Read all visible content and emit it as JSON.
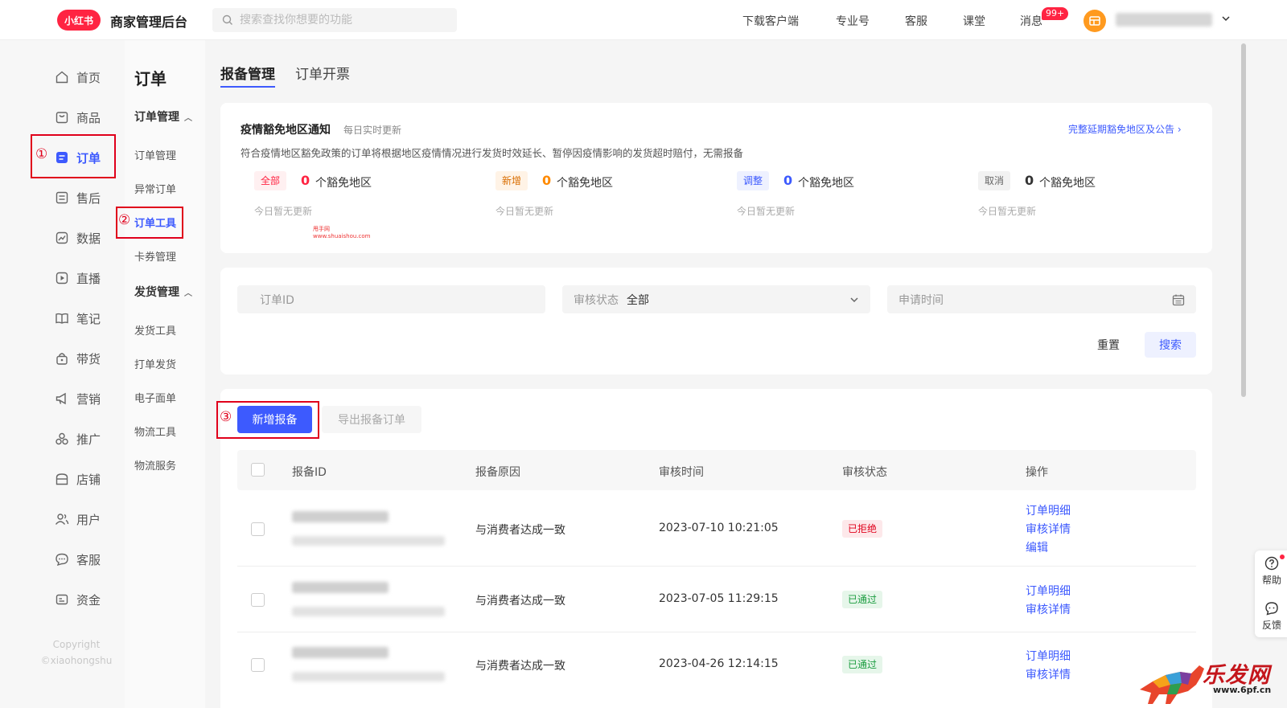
{
  "header": {
    "logo_text": "小红书",
    "title": "商家管理后台",
    "search_placeholder": "搜索查找你想要的功能",
    "nav": [
      "下载客户端",
      "专业号",
      "客服",
      "课堂",
      "消息"
    ],
    "message_badge": "99+"
  },
  "sidebar": {
    "items": [
      {
        "label": "首页",
        "icon": "home-icon"
      },
      {
        "label": "商品",
        "icon": "bag-icon"
      },
      {
        "label": "订单",
        "icon": "order-icon",
        "active": true
      },
      {
        "label": "售后",
        "icon": "aftersale-icon"
      },
      {
        "label": "数据",
        "icon": "chart-icon"
      },
      {
        "label": "直播",
        "icon": "live-icon"
      },
      {
        "label": "笔记",
        "icon": "notes-icon"
      },
      {
        "label": "带货",
        "icon": "bag-lock-icon"
      },
      {
        "label": "营销",
        "icon": "megaphone-icon"
      },
      {
        "label": "推广",
        "icon": "promote-icon"
      },
      {
        "label": "店铺",
        "icon": "store-icon"
      },
      {
        "label": "用户",
        "icon": "users-icon"
      },
      {
        "label": "客服",
        "icon": "chat-icon"
      },
      {
        "label": "资金",
        "icon": "wallet-icon"
      }
    ],
    "copyright_line1": "Copyright",
    "copyright_line2": "©xiaohongshu"
  },
  "subnav": {
    "title": "订单",
    "group1": "订单管理",
    "group1_items": [
      "订单管理",
      "异常订单",
      "订单工具",
      "卡券管理"
    ],
    "group2": "发货管理",
    "group2_items": [
      "发货工具",
      "打单发货",
      "电子面单",
      "物流工具",
      "物流服务"
    ]
  },
  "annotations": [
    "①",
    "②",
    "③"
  ],
  "tabs": [
    "报备管理",
    "订单开票"
  ],
  "notice": {
    "title": "疫情豁免地区通知",
    "subtitle": "每日实时更新",
    "link": "完整延期豁免地区及公告",
    "description": "符合疫情地区豁免政策的订单将根据地区疫情情况进行发货时效延长、暂停因疫情影响的发货超时赔付，无需报备",
    "stats": [
      {
        "tag": "全部",
        "count": "0",
        "label": "个豁免地区",
        "update": "今日暂无更新",
        "color": "#ff2442"
      },
      {
        "tag": "新增",
        "count": "0",
        "label": "个豁免地区",
        "update": "今日暂无更新",
        "color": "#ff8a00"
      },
      {
        "tag": "调整",
        "count": "0",
        "label": "个豁免地区",
        "update": "今日暂无更新",
        "color": "#3d5afe"
      },
      {
        "tag": "取消",
        "count": "0",
        "label": "个豁免地区",
        "update": "今日暂无更新",
        "color": "#333333"
      }
    ],
    "watermark_line1": "甩手网",
    "watermark_line2": "www.shuaishou.com"
  },
  "filters": {
    "order_id_placeholder": "订单ID",
    "status_label": "审核状态",
    "status_value": "全部",
    "date_placeholder": "申请时间",
    "reset": "重置",
    "search": "搜索"
  },
  "actions": {
    "add": "新增报备",
    "export": "导出报备订单"
  },
  "table": {
    "columns": [
      "报备ID",
      "报备原因",
      "审核时间",
      "审核状态",
      "操作"
    ],
    "rows": [
      {
        "reason": "与消费者达成一致",
        "time": "2023-07-10 10:21:05",
        "status": "已拒绝",
        "ops": [
          "订单明细",
          "审核详情",
          "编辑"
        ]
      },
      {
        "reason": "与消费者达成一致",
        "time": "2023-07-05 11:29:15",
        "status": "已通过",
        "ops": [
          "订单明细",
          "审核详情"
        ]
      },
      {
        "reason": "与消费者达成一致",
        "time": "2023-04-26 12:14:15",
        "status": "已通过",
        "ops": [
          "订单明细",
          "审核详情"
        ]
      }
    ]
  },
  "float": {
    "help": "帮助",
    "feedback": "反馈"
  },
  "watermark": {
    "brand": "乐发网",
    "url": "www.6pf.cn"
  },
  "colors": {
    "accent": "#3d5afe",
    "brand": "#ff2442",
    "annotation": "#e0001b"
  }
}
